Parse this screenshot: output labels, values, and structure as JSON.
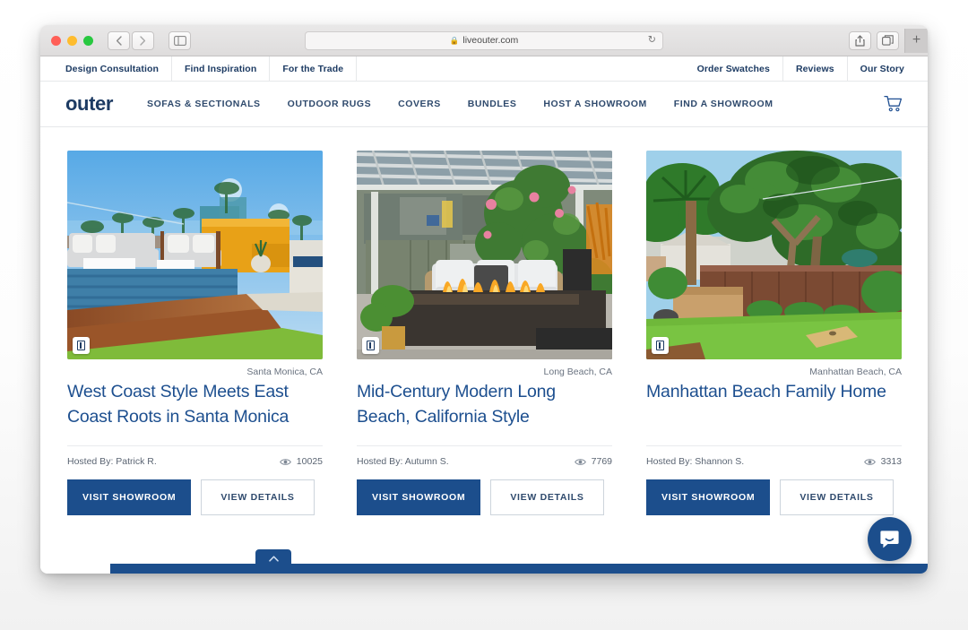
{
  "browser": {
    "url": "liveouter.com",
    "lock_icon": "lock-icon",
    "back_icon": "chevron-left-icon",
    "forward_icon": "chevron-right-icon",
    "sidebar_icon": "sidebar-toggle-icon",
    "reload_icon": "reload-icon",
    "share_icon": "share-icon",
    "tabs_icon": "tab-overview-icon",
    "new_tab_label": "+"
  },
  "site": {
    "utility_nav_left": [
      {
        "label": "Design Consultation"
      },
      {
        "label": "Find Inspiration"
      },
      {
        "label": "For the Trade"
      }
    ],
    "utility_nav_right": [
      {
        "label": "Order Swatches"
      },
      {
        "label": "Reviews"
      },
      {
        "label": "Our Story"
      }
    ],
    "logo": "outer",
    "main_nav": [
      {
        "label": "SOFAS & SECTIONALS"
      },
      {
        "label": "OUTDOOR RUGS"
      },
      {
        "label": "COVERS"
      },
      {
        "label": "BUNDLES"
      },
      {
        "label": "HOST A SHOWROOM"
      },
      {
        "label": "FIND A SHOWROOM"
      }
    ],
    "cart_icon": "shopping-cart-icon",
    "chat_icon": "chat-bubble-icon",
    "scroll_top_icon": "chevron-up-icon",
    "accent_color": "#1c4e8c",
    "title_color": "#1d4f8f"
  },
  "cards": [
    {
      "location": "Santa Monica, CA",
      "title": "West Coast Style Meets East Coast Roots in Santa Monica",
      "host": "Hosted By: Patrick R.",
      "views": "10025",
      "views_icon": "eye-icon",
      "image_badge_icon": "gallery-badge-icon",
      "primary_button": "VISIT SHOWROOM",
      "secondary_button": "VIEW DETAILS"
    },
    {
      "location": "Long Beach, CA",
      "title": "Mid-Century Modern Long Beach, California Style",
      "host": "Hosted By: Autumn S.",
      "views": "7769",
      "views_icon": "eye-icon",
      "image_badge_icon": "gallery-badge-icon",
      "primary_button": "VISIT SHOWROOM",
      "secondary_button": "VIEW DETAILS"
    },
    {
      "location": "Manhattan Beach, CA",
      "title": "Manhattan Beach Family Home",
      "host": "Hosted By: Shannon S.",
      "views": "3313",
      "views_icon": "eye-icon",
      "image_badge_icon": "gallery-badge-icon",
      "primary_button": "VISIT SHOWROOM",
      "secondary_button": "VIEW DETAILS"
    }
  ]
}
